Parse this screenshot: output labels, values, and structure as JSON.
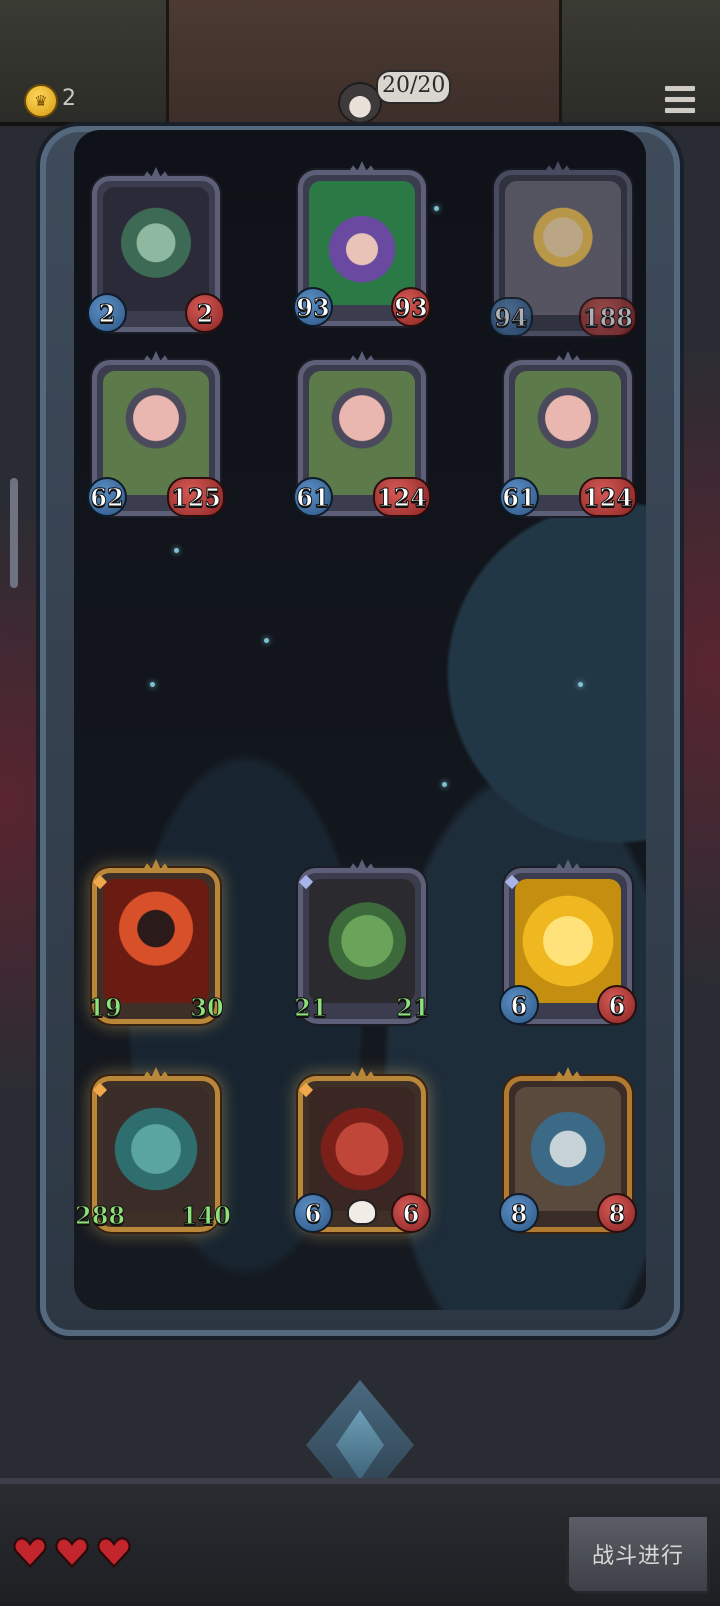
{
  "header": {
    "gold": "2",
    "hp": "20/20"
  },
  "enemies": [
    {
      "name": "witch-minion",
      "attack": "2",
      "health": "2"
    },
    {
      "name": "purple-hat-witch",
      "attack": "93",
      "health": "93"
    },
    {
      "name": "screaming-kid",
      "attack": "94",
      "health": "188"
    },
    {
      "name": "masked-pig-1",
      "attack": "62",
      "health": "125"
    },
    {
      "name": "masked-pig-2",
      "attack": "61",
      "health": "124"
    },
    {
      "name": "masked-pig-3",
      "attack": "61",
      "health": "124"
    }
  ],
  "allies": [
    {
      "name": "fire-demon",
      "attack": "19",
      "health": "30"
    },
    {
      "name": "green-dragon",
      "attack": "21",
      "health": "21"
    },
    {
      "name": "golden-dragon",
      "attack": "6",
      "health": "6"
    },
    {
      "name": "teal-dragon",
      "attack": "288",
      "health": "140"
    },
    {
      "name": "red-demon",
      "attack": "6",
      "health": "6"
    },
    {
      "name": "horned-beast",
      "attack": "8",
      "health": "8"
    }
  ],
  "lives": 3,
  "battle_button": "战斗进行",
  "colors": {
    "attack": "#3f6fa3",
    "health": "#b23838",
    "buffed_text": "#8ee27a",
    "gold_frame": "#b9873a"
  }
}
